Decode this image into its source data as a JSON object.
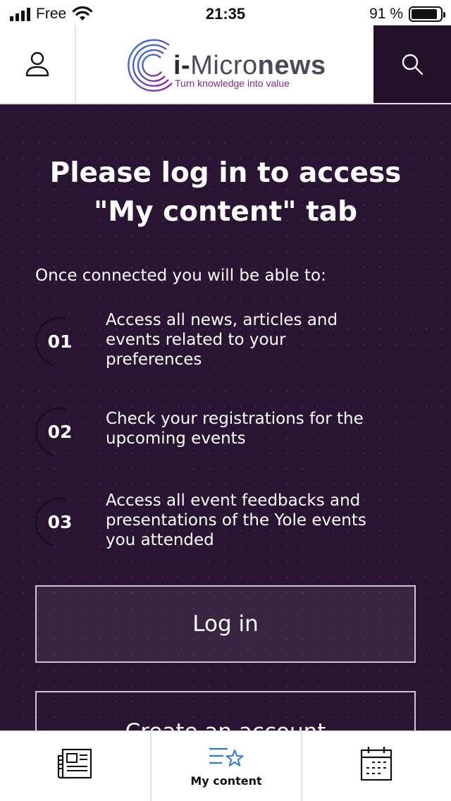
{
  "status_bar": {
    "carrier": "Free",
    "time": "21:35",
    "battery_percent": "91 %",
    "battery_level": 0.91,
    "icons": [
      "signal-icon",
      "wifi-icon",
      "battery-icon"
    ]
  },
  "header": {
    "logo_prefix": "i-",
    "logo_brand_light": "Micro",
    "logo_brand_bold": "news",
    "logo_tagline": "Turn knowledge into value",
    "profile_icon": "user-icon",
    "search_icon": "search-icon"
  },
  "main": {
    "title_line1": "Please log in to access",
    "title_line2": "\"My content\" tab",
    "intro": "Once connected you will be able to:",
    "steps": [
      {
        "number": "01",
        "lines": [
          "Access all news, articles and",
          "events related to your",
          "preferences"
        ]
      },
      {
        "number": "02",
        "lines": [
          "Check your registrations for the",
          "upcoming events"
        ]
      },
      {
        "number": "03",
        "lines": [
          "Access all event feedbacks and",
          "presentations of the Yole events",
          "you attended"
        ]
      }
    ],
    "login_label": "Log in",
    "create_account_label": "Create an account"
  },
  "tabbar": {
    "tabs": [
      {
        "icon": "news-icon",
        "label": ""
      },
      {
        "icon": "list-star-icon",
        "label": "My content",
        "active": true
      },
      {
        "icon": "calendar-icon",
        "label": ""
      }
    ]
  },
  "colors": {
    "background": "#2a1433",
    "search_button": "#231029",
    "accent_blue": "#2d7bd6",
    "tagline": "#7a2a8a"
  }
}
